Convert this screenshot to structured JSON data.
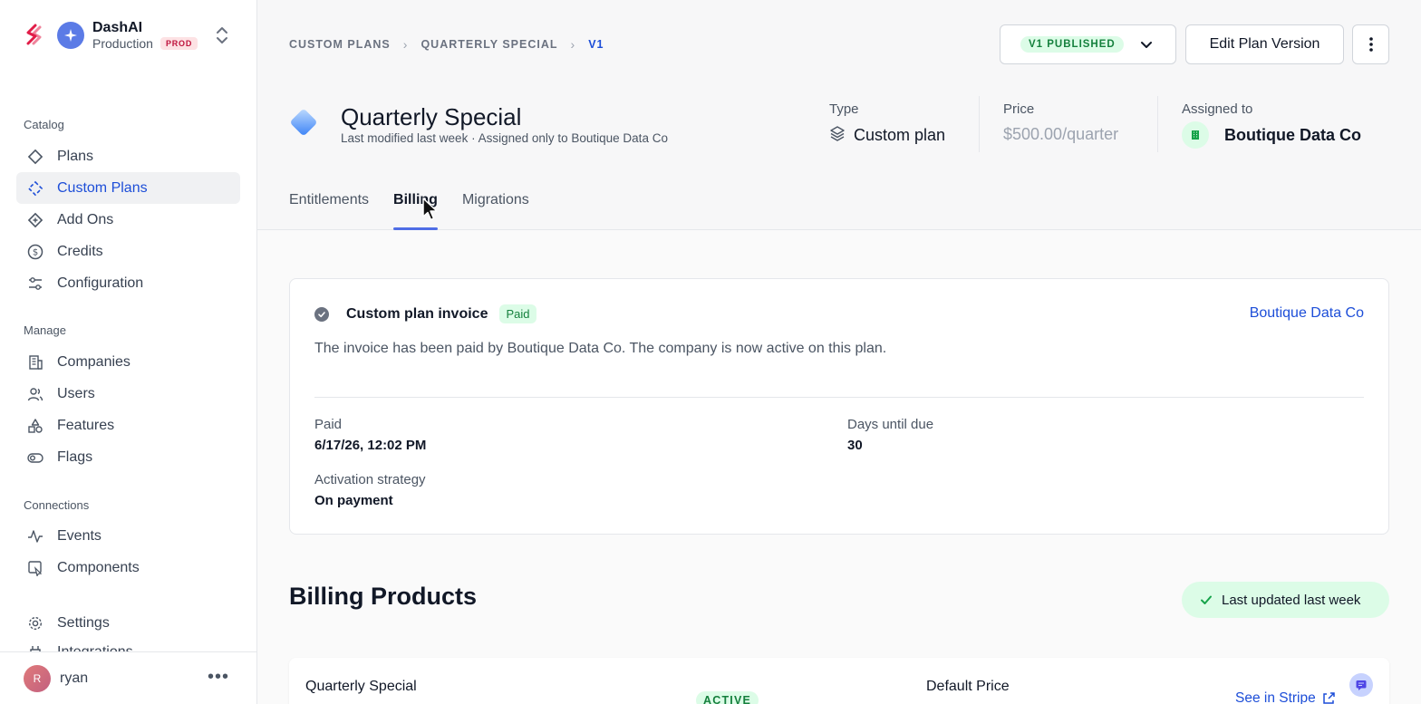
{
  "org": {
    "name": "DashAI",
    "environment": "Production",
    "env_badge": "PROD"
  },
  "sidebar": {
    "sections": {
      "catalog": "Catalog",
      "manage": "Manage",
      "connections": "Connections"
    },
    "catalog_items": [
      {
        "label": "Plans",
        "icon": "diamond-icon"
      },
      {
        "label": "Custom Plans",
        "icon": "custom-plan-icon",
        "active": true
      },
      {
        "label": "Add Ons",
        "icon": "addon-diamond-icon"
      },
      {
        "label": "Credits",
        "icon": "dollar-circle-icon"
      },
      {
        "label": "Configuration",
        "icon": "sliders-icon"
      }
    ],
    "manage_items": [
      {
        "label": "Companies",
        "icon": "building-icon"
      },
      {
        "label": "Users",
        "icon": "users-icon"
      },
      {
        "label": "Features",
        "icon": "shapes-icon"
      },
      {
        "label": "Flags",
        "icon": "toggle-icon"
      }
    ],
    "connection_items": [
      {
        "label": "Events",
        "icon": "activity-icon"
      },
      {
        "label": "Components",
        "icon": "component-icon"
      }
    ],
    "settings_label": "Settings",
    "partial_item_label": "Integrations",
    "user": {
      "initial": "R",
      "name": "ryan"
    }
  },
  "breadcrumb": [
    "CUSTOM PLANS",
    "QUARTERLY SPECIAL",
    "V1"
  ],
  "header": {
    "version_badge": "V1 PUBLISHED",
    "edit_button": "Edit Plan Version",
    "plan_title": "Quarterly Special",
    "plan_subtitle": "Last modified last week · Assigned only to Boutique Data Co",
    "type_label": "Type",
    "type_value": "Custom plan",
    "price_label": "Price",
    "price_value": "$500.00/quarter",
    "assigned_label": "Assigned to",
    "assigned_value": "Boutique Data Co"
  },
  "tabs": [
    "Entitlements",
    "Billing",
    "Migrations"
  ],
  "active_tab": "Billing",
  "invoice": {
    "title": "Custom plan invoice",
    "status": "Paid",
    "company_link": "Boutique Data Co",
    "description": "The invoice has been paid by Boutique Data Co. The company is now active on this plan.",
    "paid_label": "Paid",
    "paid_value": "6/17/26, 12:02 PM",
    "days_label": "Days until due",
    "days_value": "30",
    "activation_label": "Activation strategy",
    "activation_value": "On payment"
  },
  "billing_products": {
    "title": "Billing Products",
    "updated": "Last updated last week",
    "product_name": "Quarterly Special",
    "product_status": "ACTIVE",
    "price_label": "Default Price",
    "stripe_link": "See in Stripe"
  },
  "colors": {
    "accent": "#1d4ed8",
    "tab_underline": "#4f6de6",
    "success_bg": "#dcfce7",
    "success_text": "#15803d"
  }
}
